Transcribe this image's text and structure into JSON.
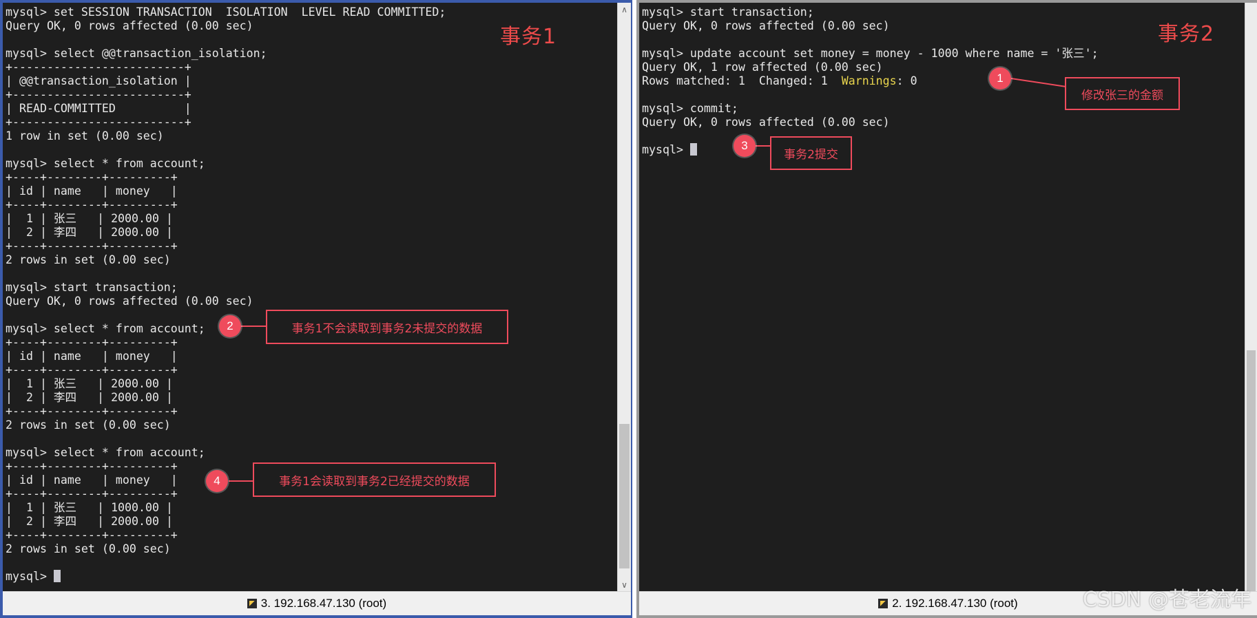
{
  "session1": {
    "label": "事务1",
    "status": "3. 192.168.47.130 (root)",
    "lines": [
      "mysql> set SESSION TRANSACTION  ISOLATION  LEVEL READ COMMITTED;",
      "Query OK, 0 rows affected (0.00 sec)",
      "",
      "mysql> select @@transaction_isolation;",
      "+-------------------------+",
      "| @@transaction_isolation |",
      "+-------------------------+",
      "| READ-COMMITTED          |",
      "+-------------------------+",
      "1 row in set (0.00 sec)",
      "",
      "mysql> select * from account;",
      "+----+--------+---------+",
      "| id | name   | money   |",
      "+----+--------+---------+",
      "|  1 | 张三   | 2000.00 |",
      "|  2 | 李四   | 2000.00 |",
      "+----+--------+---------+",
      "2 rows in set (0.00 sec)",
      "",
      "mysql> start transaction;",
      "Query OK, 0 rows affected (0.00 sec)",
      "",
      "mysql> select * from account;",
      "+----+--------+---------+",
      "| id | name   | money   |",
      "+----+--------+---------+",
      "|  1 | 张三   | 2000.00 |",
      "|  2 | 李四   | 2000.00 |",
      "+----+--------+---------+",
      "2 rows in set (0.00 sec)",
      "",
      "mysql> select * from account;",
      "+----+--------+---------+",
      "| id | name   | money   |",
      "+----+--------+---------+",
      "|  1 | 张三   | 1000.00 |",
      "|  2 | 李四   | 2000.00 |",
      "+----+--------+---------+",
      "2 rows in set (0.00 sec)",
      "",
      "mysql> "
    ]
  },
  "session2": {
    "label": "事务2",
    "status": "2. 192.168.47.130 (root)",
    "lines": [
      "mysql> start transaction;",
      "Query OK, 0 rows affected (0.00 sec)",
      "",
      "mysql> update account set money = money - 1000 where name = '张三';",
      "Query OK, 1 row affected (0.00 sec)",
      "Rows matched: 1  Changed: 1  Warnings: 0",
      "",
      "mysql> commit;",
      "Query OK, 0 rows affected (0.00 sec)",
      "",
      "mysql> "
    ]
  },
  "annotations": [
    {
      "number": "1",
      "text": "修改张三的金额"
    },
    {
      "number": "2",
      "text": "事务1不会读取到事务2未提交的数据"
    },
    {
      "number": "3",
      "text": "事务2提交"
    },
    {
      "number": "4",
      "text": "事务1会读取到事务2已经提交的数据"
    }
  ],
  "watermark": "CSDN @苍老流年",
  "icons": {
    "status": "terminal-session-icon",
    "scroll_up": "scroll-up-arrow-icon",
    "scroll_down": "scroll-down-arrow-icon"
  },
  "colors": {
    "terminal_bg": "#1e1e1e",
    "terminal_text": "#e8e8e8",
    "warning": "#e8d44d",
    "annotation": "#ef4b5c",
    "active_border": "#3b5bab"
  }
}
